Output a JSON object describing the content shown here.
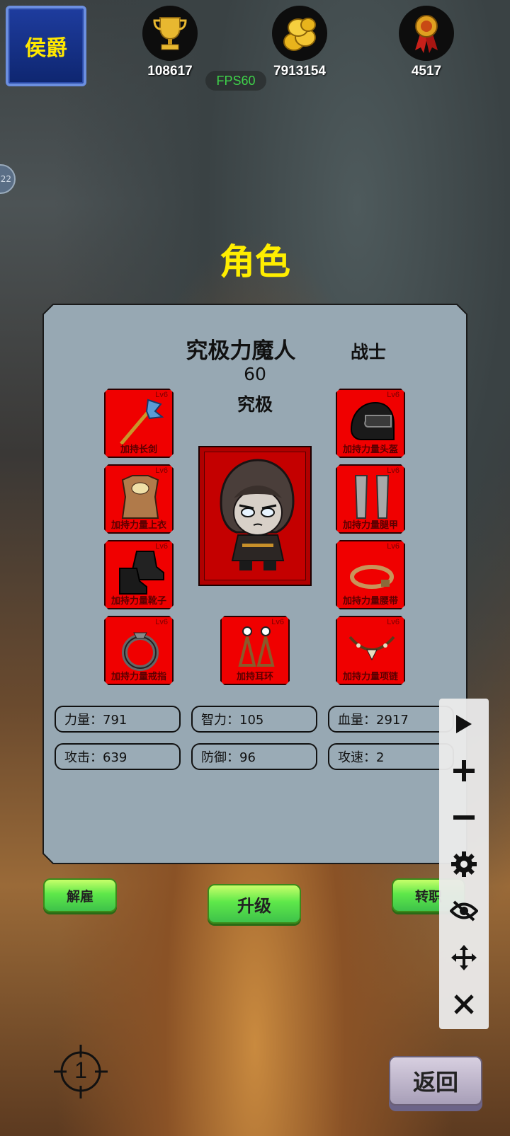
{
  "hud": {
    "rank": "侯爵",
    "trophy": "108617",
    "coins": "7913154",
    "medals": "4517",
    "fps": "FPS60",
    "side_bubble": "22"
  },
  "screen_title": "角色",
  "hero": {
    "name": "究极力魔人",
    "class": "战士",
    "level": "60",
    "grade": "究极"
  },
  "equipment": [
    {
      "lv": "Lv6",
      "caption": "加持长剑",
      "icon": "halberd-icon"
    },
    {
      "lv": "Lv6",
      "caption": "加持力量头盔",
      "icon": "helmet-icon"
    },
    {
      "lv": "Lv6",
      "caption": "加持力量上衣",
      "icon": "armor-icon"
    },
    {
      "lv": "Lv6",
      "caption": "加持力量腿甲",
      "icon": "leg-armor-icon"
    },
    {
      "lv": "Lv6",
      "caption": "加持力量靴子",
      "icon": "boots-icon"
    },
    {
      "lv": "Lv6",
      "caption": "加持力量腰带",
      "icon": "belt-icon"
    },
    {
      "lv": "Lv6",
      "caption": "加持力量戒指",
      "icon": "ring-icon"
    },
    {
      "lv": "Lv6",
      "caption": "加持耳环",
      "icon": "earring-icon"
    },
    {
      "lv": "Lv6",
      "caption": "加持力量项链",
      "icon": "necklace-icon"
    }
  ],
  "stats": [
    "力量：791",
    "智力：105",
    "血量：2917",
    "攻击：639",
    "防御：96",
    "攻速：2"
  ],
  "buttons": {
    "dismiss": "解雇",
    "upgrade": "升级",
    "change_job": "转职",
    "back": "返回"
  },
  "target_marker": "1",
  "colors": {
    "title_yellow": "#ffee00",
    "slot_red": "#f00000",
    "panel_gray": "#97a8b3"
  }
}
